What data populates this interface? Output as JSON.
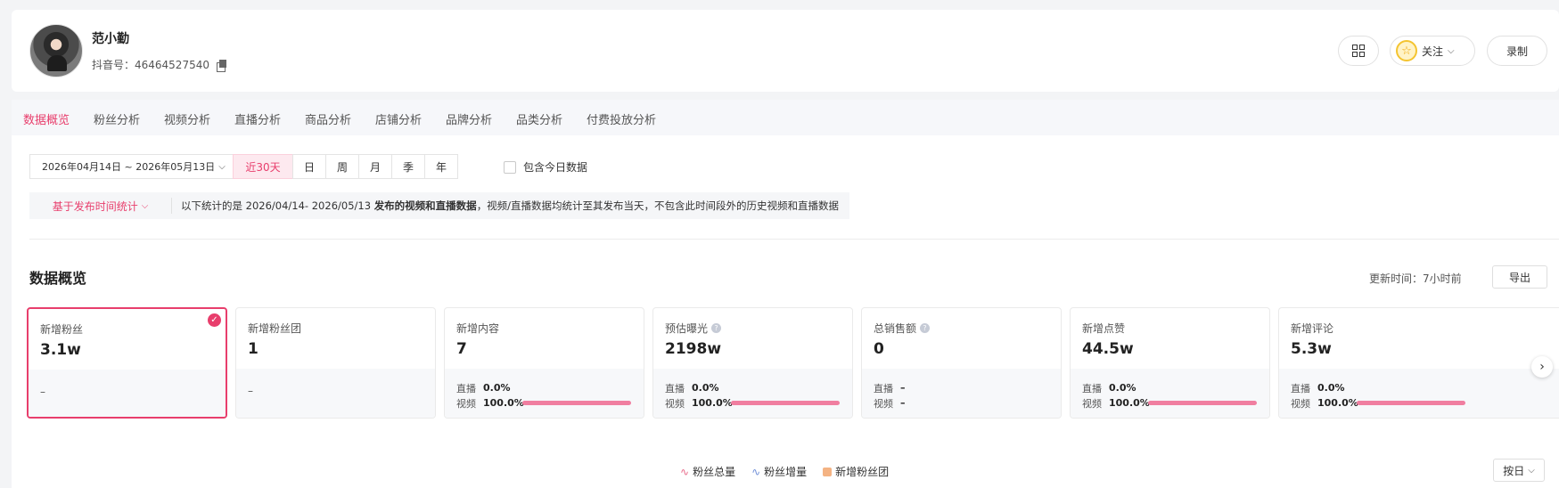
{
  "profile": {
    "name": "范小勤",
    "douyin_id": "抖音号：46464527540",
    "follow_label": "关注",
    "record_label": "录制"
  },
  "tabs": [
    "数据概览",
    "粉丝分析",
    "视频分析",
    "直播分析",
    "商品分析",
    "店铺分析",
    "品牌分析",
    "品类分析",
    "付费投放分析"
  ],
  "filters": {
    "date_range": "2026年04月14日 ~ 2026年05月13日",
    "periods": [
      "近30天",
      "日",
      "周",
      "月",
      "季",
      "年"
    ],
    "selected_period": "近30天",
    "include_today_label": "包含今日数据"
  },
  "info_bar": {
    "basis_label": "基于发布时间统计",
    "text_prefix": "以下统计的是 2026/04/14- 2026/05/13 ",
    "text_bold": "发布的视频和直播数据",
    "text_suffix": "，视频/直播数据均统计至其发布当天，不包含此时间段外的历史视频和直播数据"
  },
  "overview": {
    "title": "数据概览",
    "update_time": "更新时间：7小时前",
    "export_label": "导出"
  },
  "metrics": [
    {
      "label": "新增粉丝",
      "value": "3.1w",
      "bottom": "–"
    },
    {
      "label": "新增粉丝团",
      "value": "1",
      "bottom": "–"
    },
    {
      "label": "新增内容",
      "value": "7",
      "live_label": "直播",
      "live_value": "0.0%",
      "video_label": "视频",
      "video_value": "100.0%",
      "video_share": 1.0
    },
    {
      "label": "预估曝光",
      "value": "2198w",
      "live_label": "直播",
      "live_value": "0.0%",
      "video_label": "视频",
      "video_value": "100.0%",
      "video_share": 1.0
    },
    {
      "label": "总销售额",
      "value": "0",
      "live_label": "直播",
      "live_value": "–",
      "video_label": "视频",
      "video_value": "–"
    },
    {
      "label": "新增点赞",
      "value": "44.5w",
      "live_label": "直播",
      "live_value": "0.0%",
      "video_label": "视频",
      "video_value": "100.0%",
      "video_share": 1.0
    },
    {
      "label": "新增评论",
      "value": "5.3w",
      "live_label": "直播",
      "live_value": "0.0%",
      "video_label": "视频",
      "video_value": "100.0%",
      "video_share": 1.0
    }
  ],
  "legend": [
    "粉丝总量",
    "粉丝增量",
    "新增粉丝团"
  ],
  "granularity": "按日",
  "colors": {
    "accent": "#e83e6c",
    "bar": "#f07ea0",
    "fans_total": "#e86a8a",
    "fans_increase": "#6f8fd8",
    "fan_group": "#f4b383"
  }
}
